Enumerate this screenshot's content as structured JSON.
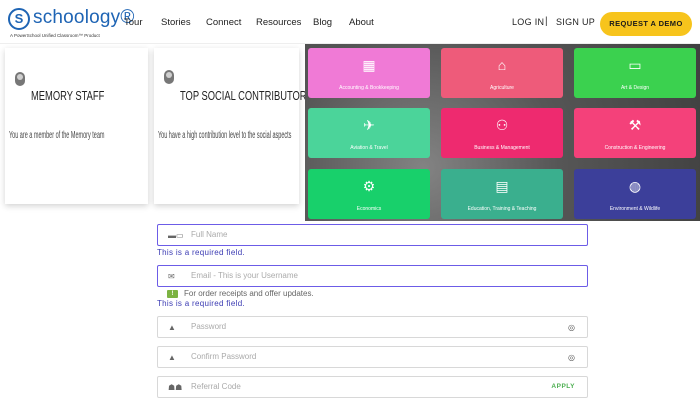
{
  "header": {
    "logo_mark": "S",
    "logo_text": "schoology®",
    "logo_tagline": "A PowerSchool Unified Classroom™ Product",
    "nav": [
      "Tour",
      "Stories",
      "Connect",
      "Resources",
      "Blog",
      "About"
    ],
    "login": "LOG IN",
    "separator": "|",
    "signup": "SIGN UP",
    "cta": "REQUEST A DEMO",
    "cta_color": "#f7c41c"
  },
  "badges": [
    {
      "title": "MEMORY STAFF",
      "description": "You are a member of the Memory team",
      "icon": "badge-icon"
    },
    {
      "title": "TOP SOCIAL CONTRIBUTOR",
      "description": "You have a high contribution level to the social aspects",
      "icon": "badge-check-icon"
    }
  ],
  "categories": [
    {
      "label": "Accounting & Bookkeeping",
      "icon": "calculator-icon",
      "glyph": "▦",
      "color": "#f07ad6"
    },
    {
      "label": "Agriculture",
      "icon": "barn-icon",
      "glyph": "⌂",
      "color": "#ee5b7a"
    },
    {
      "label": "Art & Design",
      "icon": "monitor-icon",
      "glyph": "▭",
      "color": "#3bd14f"
    },
    {
      "label": "Aviation & Travel",
      "icon": "plane-icon",
      "glyph": "✈",
      "color": "#4bd49a"
    },
    {
      "label": "Business & Management",
      "icon": "people-icon",
      "glyph": "⚇",
      "color": "#ee2a6f"
    },
    {
      "label": "Construction & Engineering",
      "icon": "tools-icon",
      "glyph": "⚒",
      "color": "#f4417a"
    },
    {
      "label": "Economics",
      "icon": "economy-icon",
      "glyph": "⚙",
      "color": "#18d06b"
    },
    {
      "label": "Education, Training & Teaching",
      "icon": "teacher-icon",
      "glyph": "▤",
      "color": "#3aaf8e"
    },
    {
      "label": "Environment & Wildlife",
      "icon": "globe-icon",
      "glyph": "◍",
      "color": "#3c3f9a"
    }
  ],
  "form": {
    "full_name_placeholder": "Full Name",
    "full_name_error": "This is a required field.",
    "email_placeholder": "Email - This is your Username",
    "email_hint": "For order receipts and offer updates.",
    "email_error": "This is a required field.",
    "password_placeholder": "Password",
    "confirm_password_placeholder": "Confirm Password",
    "referral_placeholder": "Referral Code",
    "apply_label": "APPLY"
  }
}
